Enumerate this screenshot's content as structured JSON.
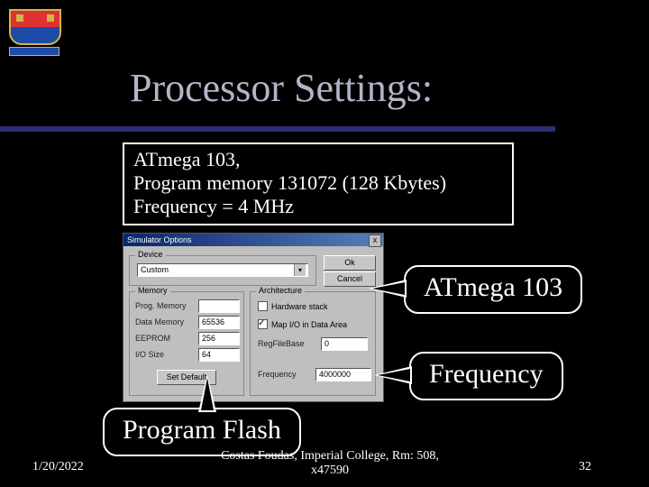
{
  "title": "Processor Settings:",
  "spec": {
    "line1": "ATmega 103,",
    "line2": "Program memory 131072 (128 Kbytes)",
    "line3": "Frequency = 4 MHz"
  },
  "dialog": {
    "title": "Simulator Options",
    "close": "x",
    "device": {
      "legend": "Device",
      "value": "Custom"
    },
    "ok": "Ok",
    "cancel": "Cancel",
    "memory": {
      "legend": "Memory",
      "prog_label": "Prog. Memory",
      "prog_value": "",
      "data_label": "Data Memory",
      "data_value": "65536",
      "eeprom_label": "EEPROM",
      "eeprom_value": "256",
      "io_label": "I/O Size",
      "io_value": "64",
      "setdefault": "Set Default"
    },
    "arch": {
      "legend": "Architecture",
      "hw_label": "Hardware stack",
      "map_label": "Map I/O in Data Area",
      "reg_label": "RegFileBase",
      "reg_value": "0",
      "freq_label": "Frequency",
      "freq_value": "4000000"
    }
  },
  "callouts": {
    "atmega": "ATmega 103",
    "frequency": "Frequency",
    "program_flash": "Program Flash"
  },
  "footer": {
    "date": "1/20/2022",
    "author": "Costas Foudas, Imperial College, Rm: 508, x47590",
    "page": "32"
  }
}
